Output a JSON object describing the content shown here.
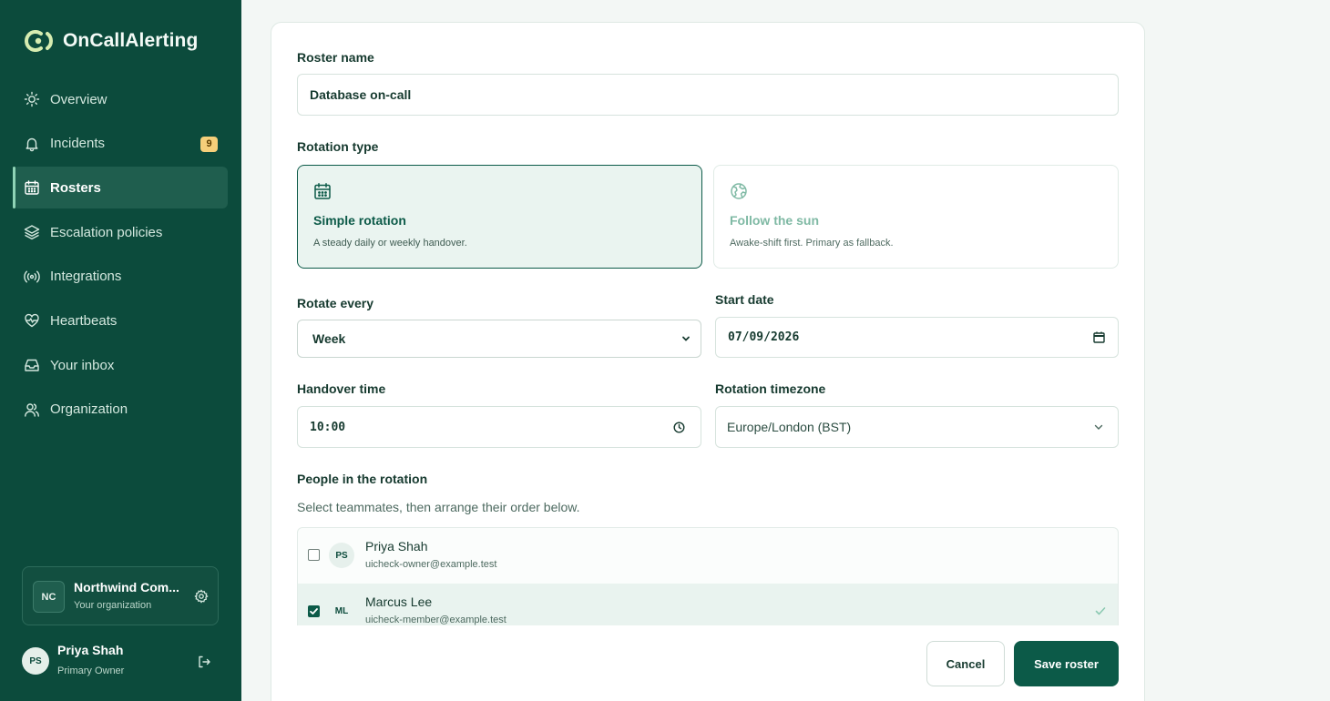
{
  "brand": {
    "name": "OnCallAlerting",
    "icon": "logo-icon"
  },
  "sidebar": {
    "items": [
      {
        "label": "Overview",
        "icon": "sun-icon"
      },
      {
        "label": "Incidents",
        "icon": "bell-icon",
        "badge": "9"
      },
      {
        "label": "Rosters",
        "icon": "calendar-icon",
        "active": true
      },
      {
        "label": "Escalation policies",
        "icon": "layers-icon"
      },
      {
        "label": "Integrations",
        "icon": "broadcast-icon"
      },
      {
        "label": "Heartbeats",
        "icon": "heart-pulse-icon"
      },
      {
        "label": "Your inbox",
        "icon": "inbox-icon"
      },
      {
        "label": "Organization",
        "icon": "users-icon"
      }
    ],
    "org": {
      "initials": "NC",
      "name": "Northwind Com...",
      "subtitle": "Your organization",
      "icon": "gear-icon"
    },
    "user": {
      "initials": "PS",
      "name": "Priya Shah",
      "role": "Primary Owner",
      "icon": "logout-icon"
    }
  },
  "form": {
    "roster_name_label": "Roster name",
    "roster_name_value": "Database on-call",
    "rotation_type_label": "Rotation type",
    "rotation_types": [
      {
        "title": "Simple rotation",
        "desc": "A steady daily or weekly handover.",
        "icon": "calendar-icon",
        "selected": true
      },
      {
        "title": "Follow the sun",
        "desc": "Awake-shift first. Primary as fallback.",
        "icon": "globe-icon",
        "selected": false
      }
    ],
    "rotate_every_label": "Rotate every",
    "rotate_every_value": "Week",
    "start_date_label": "Start date",
    "start_date_value": "07/09/2026",
    "handover_time_label": "Handover time",
    "handover_time_value": "10:00",
    "timezone_label": "Rotation timezone",
    "timezone_value": "Europe/London (BST)",
    "people_label": "People in the rotation",
    "people_hint": "Select teammates, then arrange their order below.",
    "people": [
      {
        "initials": "PS",
        "name": "Priya Shah",
        "email": "uicheck-owner@example.test",
        "checked": false
      },
      {
        "initials": "ML",
        "name": "Marcus Lee",
        "email": "uicheck-member@example.test",
        "checked": true
      }
    ],
    "cancel_label": "Cancel",
    "save_label": "Save roster"
  },
  "colors": {
    "sidebar_bg": "#0c4b3c",
    "accent": "#0c5a48",
    "badge_bg": "#f5cf7a",
    "page_bg": "#f3f7f5"
  }
}
